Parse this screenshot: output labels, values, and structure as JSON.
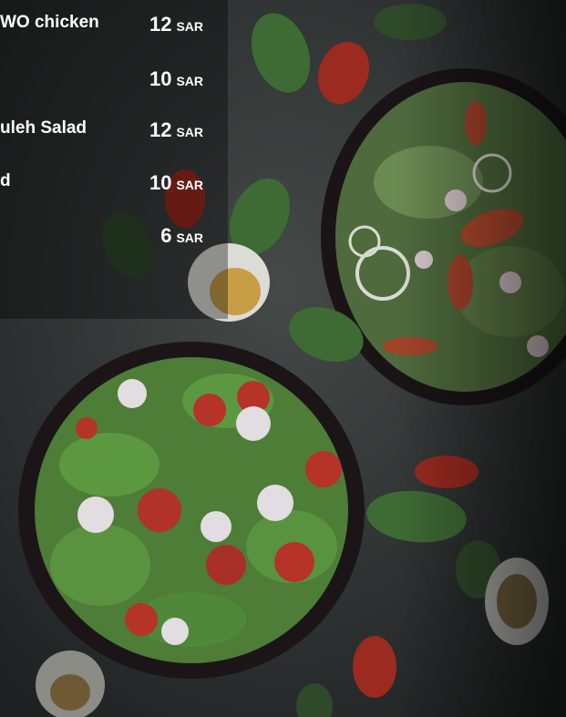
{
  "menu": {
    "items": [
      {
        "name": "WO chicken",
        "price": "12",
        "currency": "SAR"
      },
      {
        "name": "",
        "price": "10",
        "currency": "SAR"
      },
      {
        "name": "uleh Salad",
        "price": "12",
        "currency": "SAR"
      },
      {
        "name": "d",
        "price": "10",
        "currency": "SAR"
      },
      {
        "name": "",
        "price": "6",
        "currency": "SAR"
      }
    ]
  },
  "colors": {
    "background": "#2b2f2f",
    "text": "#ffffff",
    "leaf": "#3f7d3a",
    "tomato": "#a8281e",
    "bowl": "#1c1618"
  }
}
